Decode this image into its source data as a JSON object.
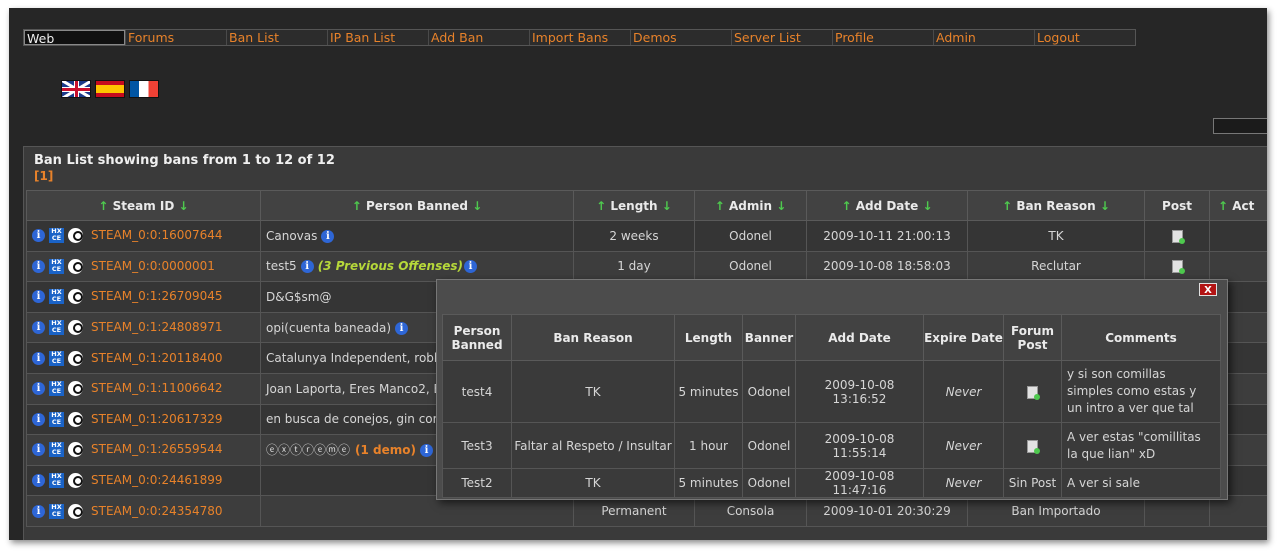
{
  "nav": [
    "Web",
    "Forums",
    "Ban List",
    "IP Ban List",
    "Add Ban",
    "Import Bans",
    "Demos",
    "Server List",
    "Profile",
    "Admin",
    "Logout"
  ],
  "flags": [
    "uk-flag",
    "spain-flag",
    "france-flag"
  ],
  "panel": {
    "title": "Ban List showing bans from 1 to 12 of 12",
    "pages": "[1]"
  },
  "columns": {
    "steam_id": "Steam ID",
    "person": "Person Banned",
    "length": "Length",
    "admin": "Admin",
    "add_date": "Add Date",
    "reason": "Ban Reason",
    "post": "Post",
    "action": "Act"
  },
  "rows": [
    {
      "steam_id": "STEAM_0:0:16007644",
      "person": "Canovas",
      "person_info": true,
      "offenses": "",
      "demo": "",
      "length": "2 weeks",
      "admin": "Odonel",
      "date": "2009-10-11 21:00:13",
      "reason": "TK",
      "post": "icon",
      "action": "check"
    },
    {
      "steam_id": "STEAM_0:0:0000001",
      "person": "test5",
      "person_info": true,
      "offenses": "(3 Previous Offenses)",
      "demo": "",
      "length": "1 day",
      "admin": "Odonel",
      "date": "2009-10-08 18:58:03",
      "reason": "Reclutar",
      "post": "icon",
      "action": "x"
    },
    {
      "steam_id": "STEAM_0:1:26709045",
      "person": "D&G$sm@",
      "person_info": false,
      "offenses": "",
      "demo": "",
      "length": "",
      "admin": "",
      "date": "",
      "reason": "",
      "post": "",
      "action": "check"
    },
    {
      "steam_id": "STEAM_0:1:24808971",
      "person": "opi(cuenta baneada)",
      "person_info": true,
      "offenses": "",
      "demo": "",
      "length": "",
      "admin": "",
      "date": "",
      "reason": "",
      "post": "",
      "action": "check"
    },
    {
      "steam_id": "STEAM_0:1:20118400",
      "person": "Catalunya Independent, robbe",
      "person_info": false,
      "offenses": "",
      "demo": "",
      "length": "",
      "admin": "",
      "date": "",
      "reason": "",
      "post": "",
      "action": "check"
    },
    {
      "steam_id": "STEAM_0:1:11006642",
      "person": "Joan Laporta, Eres Manco2, Er",
      "person_info": false,
      "offenses": "",
      "demo": "",
      "length": "",
      "admin": "",
      "date": "",
      "reason": "",
      "post": "",
      "action": "check"
    },
    {
      "steam_id": "STEAM_0:1:20617329",
      "person": "en busca de conejos, gin corru",
      "person_info": false,
      "offenses": "",
      "demo": "",
      "length": "",
      "admin": "",
      "date": "",
      "reason": "",
      "post": "",
      "action": "check"
    },
    {
      "steam_id": "STEAM_0:1:26559544",
      "person": "ⓔⓧⓣⓡⓔⓜⓔ",
      "person_info": true,
      "offenses": "",
      "demo": "(1 demo)",
      "length": "",
      "admin": "",
      "date": "",
      "reason": "",
      "post": "",
      "action": "check"
    },
    {
      "steam_id": "STEAM_0:0:24461899",
      "person": "",
      "person_info": false,
      "offenses": "",
      "demo": "",
      "length": "",
      "admin": "",
      "date": "",
      "reason": "",
      "post": "",
      "action": "check"
    },
    {
      "steam_id": "STEAM_0:0:24354780",
      "person": "",
      "person_info": false,
      "offenses": "",
      "demo": "",
      "length": "Permanent",
      "admin": "Consola",
      "date": "2009-10-01 20:30:29",
      "reason": "Ban Importado",
      "post": "",
      "action": "x"
    }
  ],
  "popup": {
    "close": "X",
    "headers": [
      "Person Banned",
      "Ban Reason",
      "Length",
      "Banner",
      "Add Date",
      "Expire Date",
      "Forum Post",
      "Comments"
    ],
    "rows": [
      {
        "person": "test4",
        "reason": "TK",
        "length": "5 minutes",
        "banner": "Odonel",
        "date": "2009-10-08 13:16:52",
        "expire": "Never",
        "post": "icon",
        "comment": "y si son comillas simples como estas y un intro a ver que tal"
      },
      {
        "person": "Test3",
        "reason": "Faltar al Respeto / Insultar",
        "length": "1 hour",
        "banner": "Odonel",
        "date": "2009-10-08 11:55:14",
        "expire": "Never",
        "post": "icon",
        "comment": "A ver estas \"comillitas la que lian\" xD"
      },
      {
        "person": "Test2",
        "reason": "TK",
        "length": "5 minutes",
        "banner": "Odonel",
        "date": "2009-10-08 11:47:16",
        "expire": "Never",
        "post": "Sin Post",
        "comment": "A ver si sale"
      }
    ]
  }
}
